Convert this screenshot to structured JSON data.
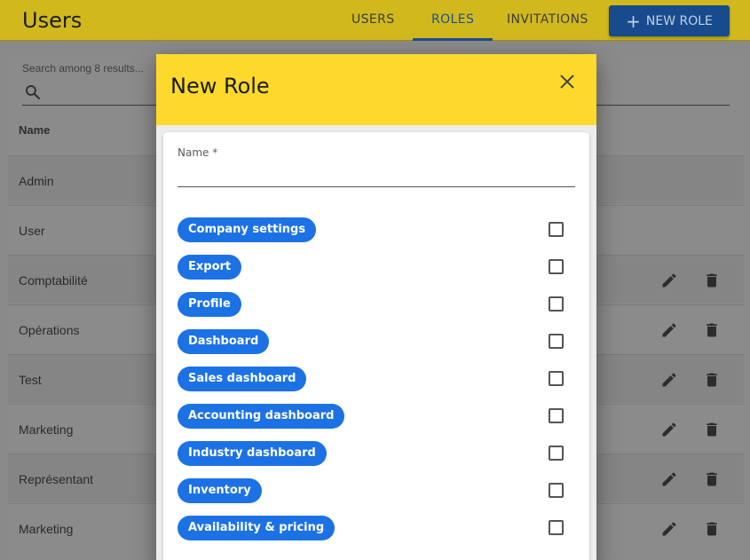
{
  "header": {
    "title": "Users",
    "tabs": [
      {
        "label": "USERS",
        "active": false
      },
      {
        "label": "ROLES",
        "active": true
      },
      {
        "label": "INVITATIONS",
        "active": false
      }
    ],
    "new_role_label": "NEW ROLE"
  },
  "search": {
    "placeholder": "Search among 8 results..."
  },
  "table": {
    "column_name": "Name",
    "rows": [
      {
        "name": "Admin",
        "editable": false
      },
      {
        "name": "User",
        "editable": false
      },
      {
        "name": "Comptabilité",
        "editable": true
      },
      {
        "name": "Opérations",
        "editable": true
      },
      {
        "name": "Test",
        "editable": true
      },
      {
        "name": "Marketing",
        "editable": true
      },
      {
        "name": "Représentant",
        "editable": true
      },
      {
        "name": "Marketing",
        "editable": true
      }
    ]
  },
  "modal": {
    "title": "New Role",
    "name_label": "Name *",
    "name_value": "",
    "permissions": [
      {
        "label": "Company settings",
        "checked": false
      },
      {
        "label": "Export",
        "checked": false
      },
      {
        "label": "Profile",
        "checked": false
      },
      {
        "label": "Dashboard",
        "checked": false
      },
      {
        "label": "Sales dashboard",
        "checked": false
      },
      {
        "label": "Accounting dashboard",
        "checked": false
      },
      {
        "label": "Industry dashboard",
        "checked": false
      },
      {
        "label": "Inventory",
        "checked": false
      },
      {
        "label": "Availability & pricing",
        "checked": false
      }
    ]
  },
  "colors": {
    "appbar": "#fcd92b",
    "primary": "#1c72e4",
    "chip": "#1c72e4"
  }
}
